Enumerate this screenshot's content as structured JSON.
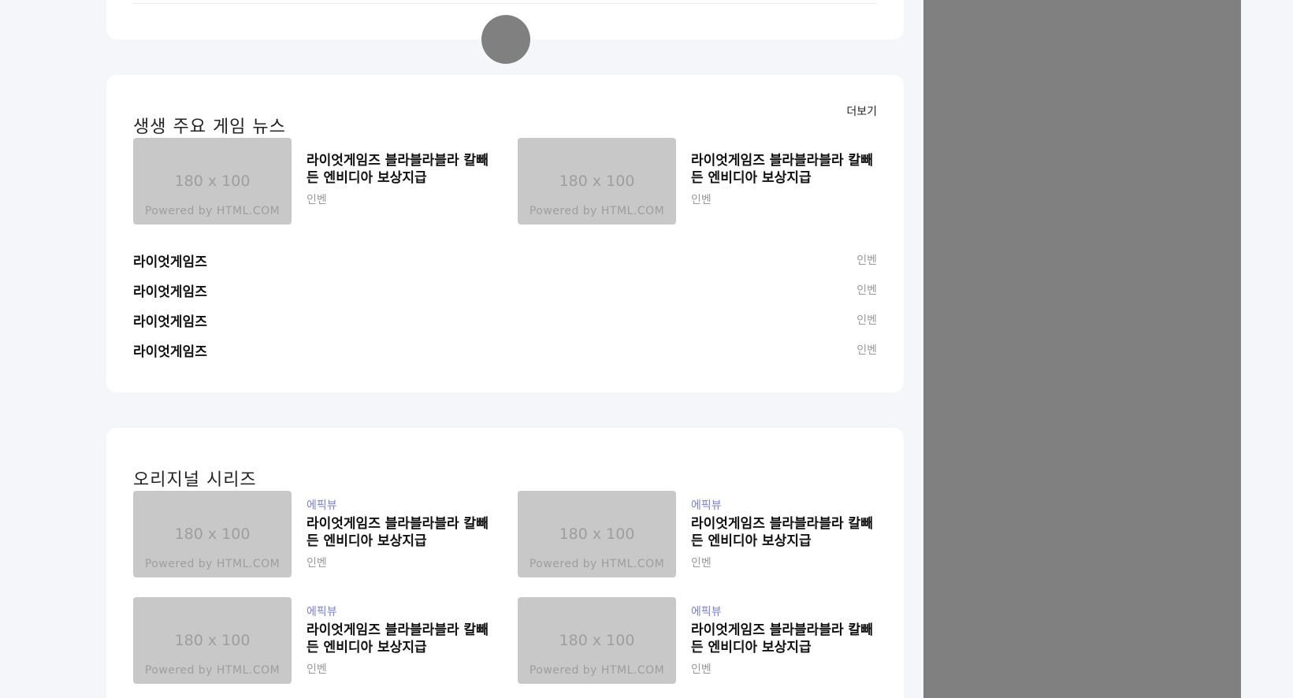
{
  "news_section": {
    "title": "생생 주요 게임 뉴스",
    "more_label": "더보기",
    "featured": [
      {
        "thumb_size": "180 x 100",
        "thumb_credit": "Powered by HTML.COM",
        "title": "라이엇게임즈 블라블라블라 칼빼든 엔비디아 보상지급",
        "source": "인벤"
      },
      {
        "thumb_size": "180 x 100",
        "thumb_credit": "Powered by HTML.COM",
        "title": "라이엇게임즈 블라블라블라 칼빼든 엔비디아 보상지급",
        "source": "인벤"
      }
    ],
    "list": [
      {
        "title": "라이엇게임즈",
        "source": "인벤"
      },
      {
        "title": "라이엇게임즈",
        "source": "인벤"
      },
      {
        "title": "라이엇게임즈",
        "source": "인벤"
      },
      {
        "title": "라이엇게임즈",
        "source": "인벤"
      }
    ]
  },
  "series_section": {
    "title": "오리지널 시리즈",
    "items": [
      {
        "thumb_size": "180 x 100",
        "thumb_credit": "Powered by HTML.COM",
        "tag": "에픽뷰",
        "title": "라이엇게임즈 블라블라블라 칼빼든 엔비디아 보상지급",
        "source": "인벤"
      },
      {
        "thumb_size": "180 x 100",
        "thumb_credit": "Powered by HTML.COM",
        "tag": "에픽뷰",
        "title": "라이엇게임즈 블라블라블라 칼빼든 엔비디아 보상지급",
        "source": "인벤"
      },
      {
        "thumb_size": "180 x 100",
        "thumb_credit": "Powered by HTML.COM",
        "tag": "에픽뷰",
        "title": "라이엇게임즈 블라블라블라 칼빼든 엔비디아 보상지급",
        "source": "인벤"
      },
      {
        "thumb_size": "180 x 100",
        "thumb_credit": "Powered by HTML.COM",
        "tag": "에픽뷰",
        "title": "라이엇게임즈 블라블라블라 칼빼든 엔비디아 보상지급",
        "source": "인벤"
      }
    ]
  },
  "colors": {
    "page_background": "#f5f6fa",
    "card_background": "#ffffff",
    "thumbnail_placeholder": "#c8c8c8",
    "tag_accent": "#7a7fe8",
    "side_panel": "#808080",
    "scroll_indicator": "#808080"
  }
}
